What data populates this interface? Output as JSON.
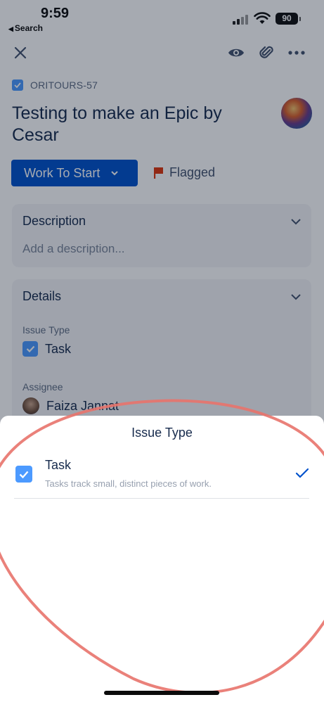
{
  "status_bar": {
    "time": "9:59",
    "back_label": "Search",
    "battery": "90"
  },
  "toolbar": {
    "close_icon": "close-icon",
    "watch_icon": "eye-icon",
    "attach_icon": "paperclip-icon",
    "more_icon": "more-icon"
  },
  "issue": {
    "key": "ORITOURS-57",
    "title": "Testing to make an Epic by Cesar",
    "status_label": "Work To Start",
    "flag_label": "Flagged"
  },
  "description": {
    "heading": "Description",
    "placeholder": "Add a description..."
  },
  "details": {
    "heading": "Details",
    "issue_type_label": "Issue Type",
    "issue_type_value": "Task",
    "assignee_label": "Assignee",
    "assignee_value": "Faiza Jannat"
  },
  "sheet": {
    "title": "Issue Type",
    "options": [
      {
        "name": "Task",
        "description": "Tasks track small, distinct pieces of work.",
        "selected": true
      }
    ]
  },
  "colors": {
    "primary": "#0052cc",
    "task_icon": "#4c9aff",
    "flag": "#de350b",
    "annotation": "#e8736c"
  }
}
